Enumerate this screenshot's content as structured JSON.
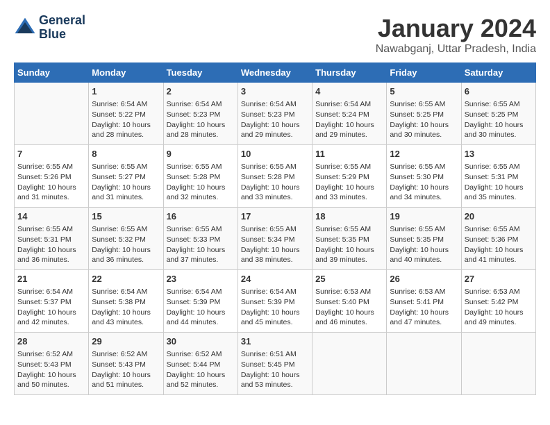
{
  "logo": {
    "line1": "General",
    "line2": "Blue"
  },
  "title": "January 2024",
  "subtitle": "Nawabganj, Uttar Pradesh, India",
  "days_of_week": [
    "Sunday",
    "Monday",
    "Tuesday",
    "Wednesday",
    "Thursday",
    "Friday",
    "Saturday"
  ],
  "weeks": [
    [
      {
        "day": "",
        "info": ""
      },
      {
        "day": "1",
        "info": "Sunrise: 6:54 AM\nSunset: 5:22 PM\nDaylight: 10 hours\nand 28 minutes."
      },
      {
        "day": "2",
        "info": "Sunrise: 6:54 AM\nSunset: 5:23 PM\nDaylight: 10 hours\nand 28 minutes."
      },
      {
        "day": "3",
        "info": "Sunrise: 6:54 AM\nSunset: 5:23 PM\nDaylight: 10 hours\nand 29 minutes."
      },
      {
        "day": "4",
        "info": "Sunrise: 6:54 AM\nSunset: 5:24 PM\nDaylight: 10 hours\nand 29 minutes."
      },
      {
        "day": "5",
        "info": "Sunrise: 6:55 AM\nSunset: 5:25 PM\nDaylight: 10 hours\nand 30 minutes."
      },
      {
        "day": "6",
        "info": "Sunrise: 6:55 AM\nSunset: 5:25 PM\nDaylight: 10 hours\nand 30 minutes."
      }
    ],
    [
      {
        "day": "7",
        "info": "Sunrise: 6:55 AM\nSunset: 5:26 PM\nDaylight: 10 hours\nand 31 minutes."
      },
      {
        "day": "8",
        "info": "Sunrise: 6:55 AM\nSunset: 5:27 PM\nDaylight: 10 hours\nand 31 minutes."
      },
      {
        "day": "9",
        "info": "Sunrise: 6:55 AM\nSunset: 5:28 PM\nDaylight: 10 hours\nand 32 minutes."
      },
      {
        "day": "10",
        "info": "Sunrise: 6:55 AM\nSunset: 5:28 PM\nDaylight: 10 hours\nand 33 minutes."
      },
      {
        "day": "11",
        "info": "Sunrise: 6:55 AM\nSunset: 5:29 PM\nDaylight: 10 hours\nand 33 minutes."
      },
      {
        "day": "12",
        "info": "Sunrise: 6:55 AM\nSunset: 5:30 PM\nDaylight: 10 hours\nand 34 minutes."
      },
      {
        "day": "13",
        "info": "Sunrise: 6:55 AM\nSunset: 5:31 PM\nDaylight: 10 hours\nand 35 minutes."
      }
    ],
    [
      {
        "day": "14",
        "info": "Sunrise: 6:55 AM\nSunset: 5:31 PM\nDaylight: 10 hours\nand 36 minutes."
      },
      {
        "day": "15",
        "info": "Sunrise: 6:55 AM\nSunset: 5:32 PM\nDaylight: 10 hours\nand 36 minutes."
      },
      {
        "day": "16",
        "info": "Sunrise: 6:55 AM\nSunset: 5:33 PM\nDaylight: 10 hours\nand 37 minutes."
      },
      {
        "day": "17",
        "info": "Sunrise: 6:55 AM\nSunset: 5:34 PM\nDaylight: 10 hours\nand 38 minutes."
      },
      {
        "day": "18",
        "info": "Sunrise: 6:55 AM\nSunset: 5:35 PM\nDaylight: 10 hours\nand 39 minutes."
      },
      {
        "day": "19",
        "info": "Sunrise: 6:55 AM\nSunset: 5:35 PM\nDaylight: 10 hours\nand 40 minutes."
      },
      {
        "day": "20",
        "info": "Sunrise: 6:55 AM\nSunset: 5:36 PM\nDaylight: 10 hours\nand 41 minutes."
      }
    ],
    [
      {
        "day": "21",
        "info": "Sunrise: 6:54 AM\nSunset: 5:37 PM\nDaylight: 10 hours\nand 42 minutes."
      },
      {
        "day": "22",
        "info": "Sunrise: 6:54 AM\nSunset: 5:38 PM\nDaylight: 10 hours\nand 43 minutes."
      },
      {
        "day": "23",
        "info": "Sunrise: 6:54 AM\nSunset: 5:39 PM\nDaylight: 10 hours\nand 44 minutes."
      },
      {
        "day": "24",
        "info": "Sunrise: 6:54 AM\nSunset: 5:39 PM\nDaylight: 10 hours\nand 45 minutes."
      },
      {
        "day": "25",
        "info": "Sunrise: 6:53 AM\nSunset: 5:40 PM\nDaylight: 10 hours\nand 46 minutes."
      },
      {
        "day": "26",
        "info": "Sunrise: 6:53 AM\nSunset: 5:41 PM\nDaylight: 10 hours\nand 47 minutes."
      },
      {
        "day": "27",
        "info": "Sunrise: 6:53 AM\nSunset: 5:42 PM\nDaylight: 10 hours\nand 49 minutes."
      }
    ],
    [
      {
        "day": "28",
        "info": "Sunrise: 6:52 AM\nSunset: 5:43 PM\nDaylight: 10 hours\nand 50 minutes."
      },
      {
        "day": "29",
        "info": "Sunrise: 6:52 AM\nSunset: 5:43 PM\nDaylight: 10 hours\nand 51 minutes."
      },
      {
        "day": "30",
        "info": "Sunrise: 6:52 AM\nSunset: 5:44 PM\nDaylight: 10 hours\nand 52 minutes."
      },
      {
        "day": "31",
        "info": "Sunrise: 6:51 AM\nSunset: 5:45 PM\nDaylight: 10 hours\nand 53 minutes."
      },
      {
        "day": "",
        "info": ""
      },
      {
        "day": "",
        "info": ""
      },
      {
        "day": "",
        "info": ""
      }
    ]
  ]
}
